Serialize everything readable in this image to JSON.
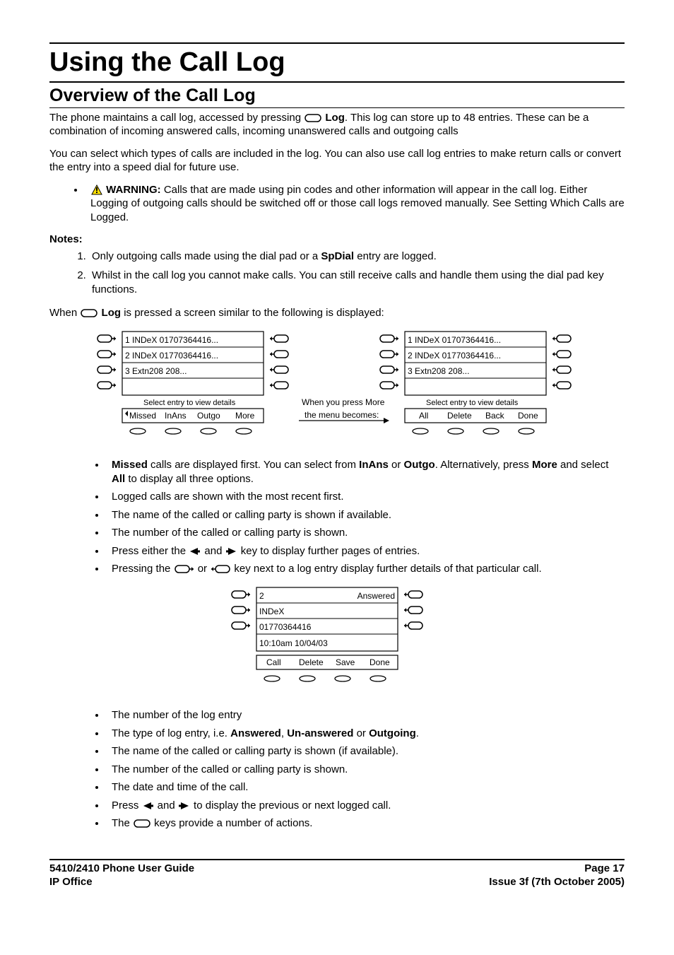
{
  "heading1": "Using the Call Log",
  "heading2": "Overview of the Call Log",
  "intro1a": "The phone maintains a call log, accessed by pressing ",
  "intro1b": "Log",
  "intro1c": ". This log can store up to 48 entries. These can be a combination of incoming answered calls, incoming unanswered calls and outgoing calls",
  "intro2": "You can select which types of calls are included in the log. You can also use call log entries to make return calls or convert the entry into a speed dial for future use.",
  "warn_label": "WARNING:",
  "warn_text": " Calls that are made using pin codes and other information will appear in the call log. Either Logging of outgoing calls should be switched off or those call logs removed manually. See Setting Which Calls are Logged.",
  "notes_label": "Notes:",
  "note1a": "Only outgoing calls made using the dial pad or a ",
  "note1b": "SpDial",
  "note1c": " entry are logged.",
  "note2": "Whilst in the call log you cannot make calls. You can still receive calls and handle them using the dial pad key functions.",
  "when1a": "When ",
  "when1b": "Log",
  "when1c": " is pressed a screen similar to the following is displayed:",
  "fig1": {
    "row1": "1  INDeX           01707364416...",
    "row2": "2  INDeX           01770364416...",
    "row3": "3  Extn208                    208...",
    "prompt": "Select entry to view details",
    "softL": [
      "Missed",
      "InAns",
      "Outgo",
      "More"
    ],
    "softR": [
      "All",
      "Delete",
      "Back",
      "Done"
    ],
    "mid1": "When you press More",
    "mid2": "the menu becomes:"
  },
  "bulletsA": {
    "b1a": "Missed",
    "b1b": " calls are displayed first. You can select from ",
    "b1c": "InAns",
    "b1d": " or ",
    "b1e": "Outgo",
    "b1f": ". Alternatively, press ",
    "b1g": "More",
    "b1h": " and select ",
    "b1i": "All",
    "b1j": " to display all three options.",
    "b2": "Logged calls are shown with the most recent first.",
    "b3": "The name of the called or calling party is shown if available.",
    "b4": "The number of the called or calling party is shown.",
    "b5a": "Press either the ",
    "b5b": " and ",
    "b5c": " key to display further pages of entries.",
    "b6a": "Pressing the ",
    "b6b": " or ",
    "b6c": " key next to a log entry display further details of that particular call."
  },
  "fig2": {
    "l1a": "2",
    "l1b": "Answered",
    "l2": "INDeX",
    "l3": "01770364416",
    "l4": "10:10am   10/04/03",
    "soft": [
      "Call",
      "Delete",
      "Save",
      "Done"
    ]
  },
  "bulletsB": {
    "b1": "The number of the log entry",
    "b2a": "The type of log entry, i.e. ",
    "b2b": "Answered",
    "b2c": ", ",
    "b2d": "Un-answered",
    "b2e": " or ",
    "b2f": "Outgoing",
    "b2g": ".",
    "b3": "The name of the called or calling party is shown (if available).",
    "b4": "The number of the called or calling party is shown.",
    "b5": "The date and time of the call.",
    "b6a": "Press ",
    "b6b": " and ",
    "b6c": " to display the previous or next logged call.",
    "b7a": "The ",
    "b7b": " keys provide a number of actions."
  },
  "footer": {
    "left1": "5410/2410 Phone User Guide",
    "left2": "IP Office",
    "right1": "Page 17",
    "right2": "Issue 3f (7th October 2005)"
  }
}
